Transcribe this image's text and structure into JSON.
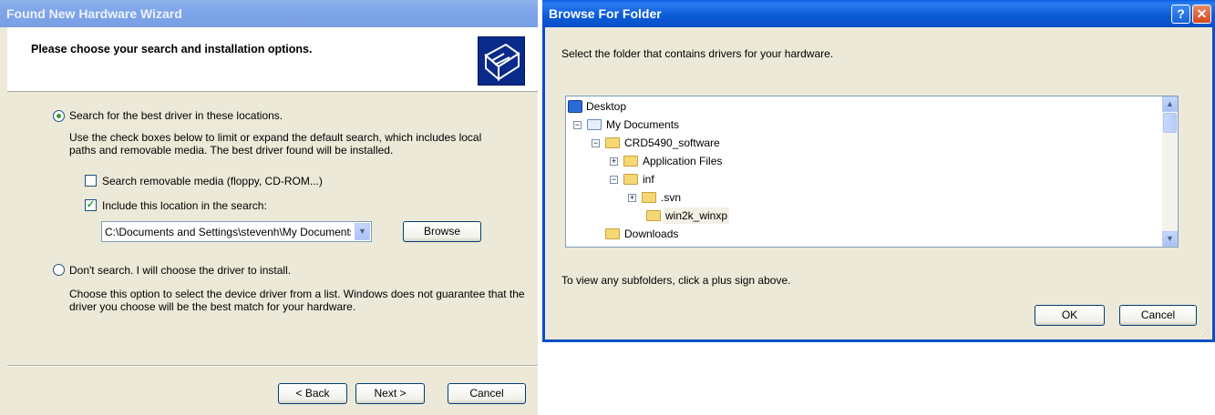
{
  "wizard": {
    "title": "Found New Hardware Wizard",
    "heading": "Please choose your search and installation options.",
    "option_search_label": "Search for the best driver in these locations.",
    "option_search_desc": "Use the check boxes below to limit or expand the default search, which includes local paths and removable media. The best driver found will be installed.",
    "check_removable_label": "Search removable media (floppy, CD-ROM...)",
    "check_removable_checked": false,
    "check_location_label": "Include this location in the search:",
    "check_location_checked": true,
    "location_value": "C:\\Documents and Settings\\stevenh\\My Documents",
    "browse_label": "Browse",
    "option_dont_label": "Don't search. I will choose the driver to install.",
    "option_dont_desc": "Choose this option to select the device driver from a list.  Windows does not guarantee that the driver you choose will be the best match for your hardware.",
    "back_label": "< Back",
    "next_label": "Next >",
    "cancel_label": "Cancel"
  },
  "browse": {
    "title": "Browse For Folder",
    "help_icon": "?",
    "close_icon": "✕",
    "instruction": "Select the folder that contains drivers for your hardware.",
    "tree": [
      {
        "label": "Desktop"
      },
      {
        "label": "My Documents"
      },
      {
        "label": "CRD5490_software"
      },
      {
        "label": "Application Files"
      },
      {
        "label": "inf"
      },
      {
        "label": ".svn"
      },
      {
        "label": "win2k_winxp"
      },
      {
        "label": "Downloads"
      }
    ],
    "hint": "To view any subfolders, click a plus sign above.",
    "ok_label": "OK",
    "cancel_label": "Cancel"
  }
}
